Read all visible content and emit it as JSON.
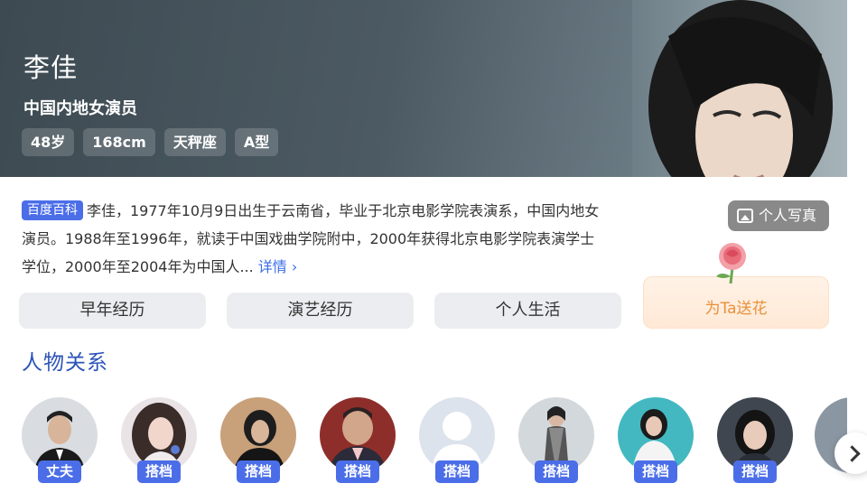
{
  "profile": {
    "name": "李佳",
    "subtitle": "中国内地女演员",
    "tags": [
      "48岁",
      "168cm",
      "天秤座",
      "A型"
    ],
    "photo_button": "个人写真"
  },
  "intro": {
    "source_badge": "百度百科",
    "text": "李佳，1977年10月9日出生于云南省，毕业于北京电影学院表演系，中国内地女演员。1988年至1996年，就读于中国戏曲学院附中，2000年获得北京电影学院表演学士学位，2000年至2004年为中国人...",
    "more_link": "详情 ›"
  },
  "flower": {
    "label": "为Ta送花"
  },
  "tabs": [
    "早年经历",
    "演艺经历",
    "个人生活"
  ],
  "relations": {
    "title": "人物关系",
    "people": [
      {
        "relation": "丈夫"
      },
      {
        "relation": "搭档"
      },
      {
        "relation": "搭档"
      },
      {
        "relation": "搭档"
      },
      {
        "relation": "搭档"
      },
      {
        "relation": "搭档"
      },
      {
        "relation": "搭档"
      },
      {
        "relation": "搭档"
      }
    ]
  },
  "colors": {
    "hero_bg": "#4c5a63",
    "accent_blue": "#4b6ee8",
    "section_title": "#2c53b8",
    "flower_text": "#e8913a"
  },
  "icons": {
    "photo": "picture-icon",
    "next": "chevron-right-icon",
    "flower": "rose-icon"
  }
}
